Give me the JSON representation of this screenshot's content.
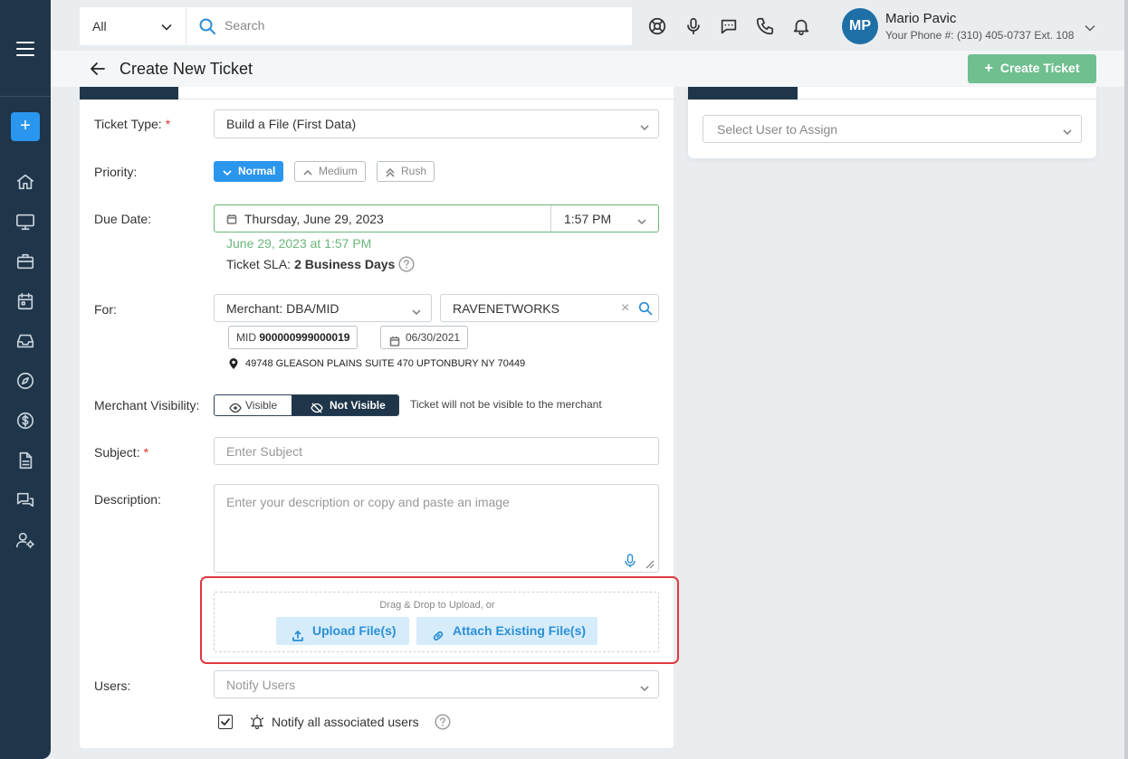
{
  "sidebar": {
    "nav": [
      "home-icon",
      "monitor-icon",
      "briefcase-icon",
      "calendar-icon",
      "inbox-icon",
      "compass-icon",
      "dollar-icon",
      "document-icon",
      "chat-icon",
      "user-settings-icon"
    ]
  },
  "topbar": {
    "scope": "All",
    "search_placeholder": "Search",
    "user": {
      "initials": "MP",
      "name": "Mario Pavic",
      "phone": "Your Phone #: (310) 405-0737 Ext. 108"
    }
  },
  "header": {
    "title": "Create New Ticket",
    "create_label": "Create Ticket"
  },
  "form": {
    "ticket_type_label": "Ticket Type:",
    "ticket_type_value": "Build a File (First Data)",
    "priority_label": "Priority:",
    "priority_options": [
      "Normal",
      "Medium",
      "Rush"
    ],
    "priority_selected": "Normal",
    "due_date_label": "Due Date:",
    "due_date": "Thursday, June 29, 2023",
    "due_time": "1:57 PM",
    "due_summary": "June 29, 2023 at 1:57 PM",
    "sla_label": "Ticket SLA:",
    "sla_value": "2 Business Days",
    "for_label": "For:",
    "for_type": "Merchant: DBA/MID",
    "for_value": "RAVENETWORKS",
    "mid_label": "MID",
    "mid_value": "900000999000019",
    "merchant_date": "06/30/2021",
    "address": "49748 GLEASON PLAINS SUITE 470 UPTONBURY NY 70449",
    "visibility_label": "Merchant Visibility:",
    "visible_label": "Visible",
    "not_visible_label": "Not Visible",
    "visibility_note": "Ticket will not be visible to the merchant",
    "subject_label": "Subject:",
    "subject_placeholder": "Enter Subject",
    "description_label": "Description:",
    "description_placeholder": "Enter your description or copy and paste an image",
    "dropzone_text": "Drag & Drop to Upload, or",
    "upload_label": "Upload File(s)",
    "attach_label": "Attach Existing File(s)",
    "users_label": "Users:",
    "users_placeholder": "Notify Users",
    "notify_all_label": "Notify all associated users",
    "notify_all_checked": true
  },
  "assign": {
    "placeholder": "Select User to Assign"
  },
  "colors": {
    "sidebar": "#1f3549",
    "primary": "#2b96ee",
    "success": "#6fbf8f",
    "highlight": "#e0393e"
  }
}
